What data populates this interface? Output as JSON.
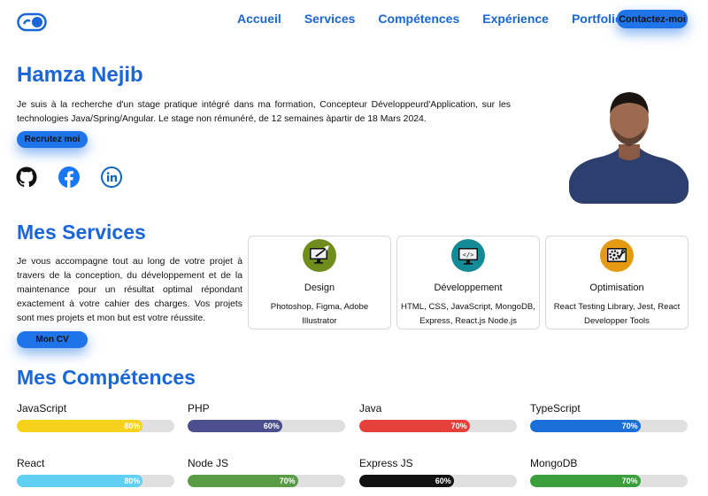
{
  "nav": {
    "logo": "toggle-logo-icon",
    "items": [
      "Accueil",
      "Services",
      "Compétences",
      "Expérience",
      "Portfolio"
    ],
    "contact_label": "Contactez-moi"
  },
  "hero": {
    "name": "Hamza Nejib",
    "text": "Je suis à la recherche d'un stage pratique intégré dans ma formation, Concepteur Développeurd'Application, sur les technologies Java/Spring/Angular. Le stage non rémunéré, de 12 semaines àpartir de 18 Mars 2024.",
    "hire_label": "Recrutez moi",
    "socials": [
      "github-icon",
      "facebook-icon",
      "linkedin-icon"
    ]
  },
  "services": {
    "title": "Mes Services",
    "text": "Je vous accompagne tout au long de votre projet à travers de la conception, du développement et de la maintenance pour un résultat optimal répondant exactement à votre cahier des charges. Vos projets sont mes projets et mon but est votre réussite.",
    "cv_label": "Mon CV",
    "cards": [
      {
        "title": "Design",
        "desc": "Photoshop, Figma, Adobe Illustrator",
        "icon": "design-monitor-icon",
        "color": "#6f8d1c"
      },
      {
        "title": "Développement",
        "desc": "HTML, CSS, JavaScript, MongoDB, Express, React.js Node.js",
        "icon": "code-monitor-icon",
        "color": "#138a96"
      },
      {
        "title": "Optimisation",
        "desc": "React Testing Library, Jest, React Developper Tools",
        "icon": "gear-tools-icon",
        "color": "#e59a14"
      }
    ]
  },
  "skills": {
    "title": "Mes Compétences",
    "items": [
      {
        "name": "JavaScript",
        "percent": "80%",
        "level": 0.8,
        "color": "#f7d21a"
      },
      {
        "name": "PHP",
        "percent": "60%",
        "level": 0.6,
        "color": "#4b4f8e"
      },
      {
        "name": "Java",
        "percent": "70%",
        "level": 0.7,
        "color": "#e6403a"
      },
      {
        "name": "TypeScript",
        "percent": "70%",
        "level": 0.7,
        "color": "#1a70d8"
      },
      {
        "name": "React",
        "percent": "80%",
        "level": 0.8,
        "color": "#5fd0f2"
      },
      {
        "name": "Node JS",
        "percent": "70%",
        "level": 0.7,
        "color": "#5a9c45"
      },
      {
        "name": "Express JS",
        "percent": "60%",
        "level": 0.6,
        "color": "#111111"
      },
      {
        "name": "MongoDB",
        "percent": "70%",
        "level": 0.7,
        "color": "#3a9e3a"
      }
    ]
  }
}
